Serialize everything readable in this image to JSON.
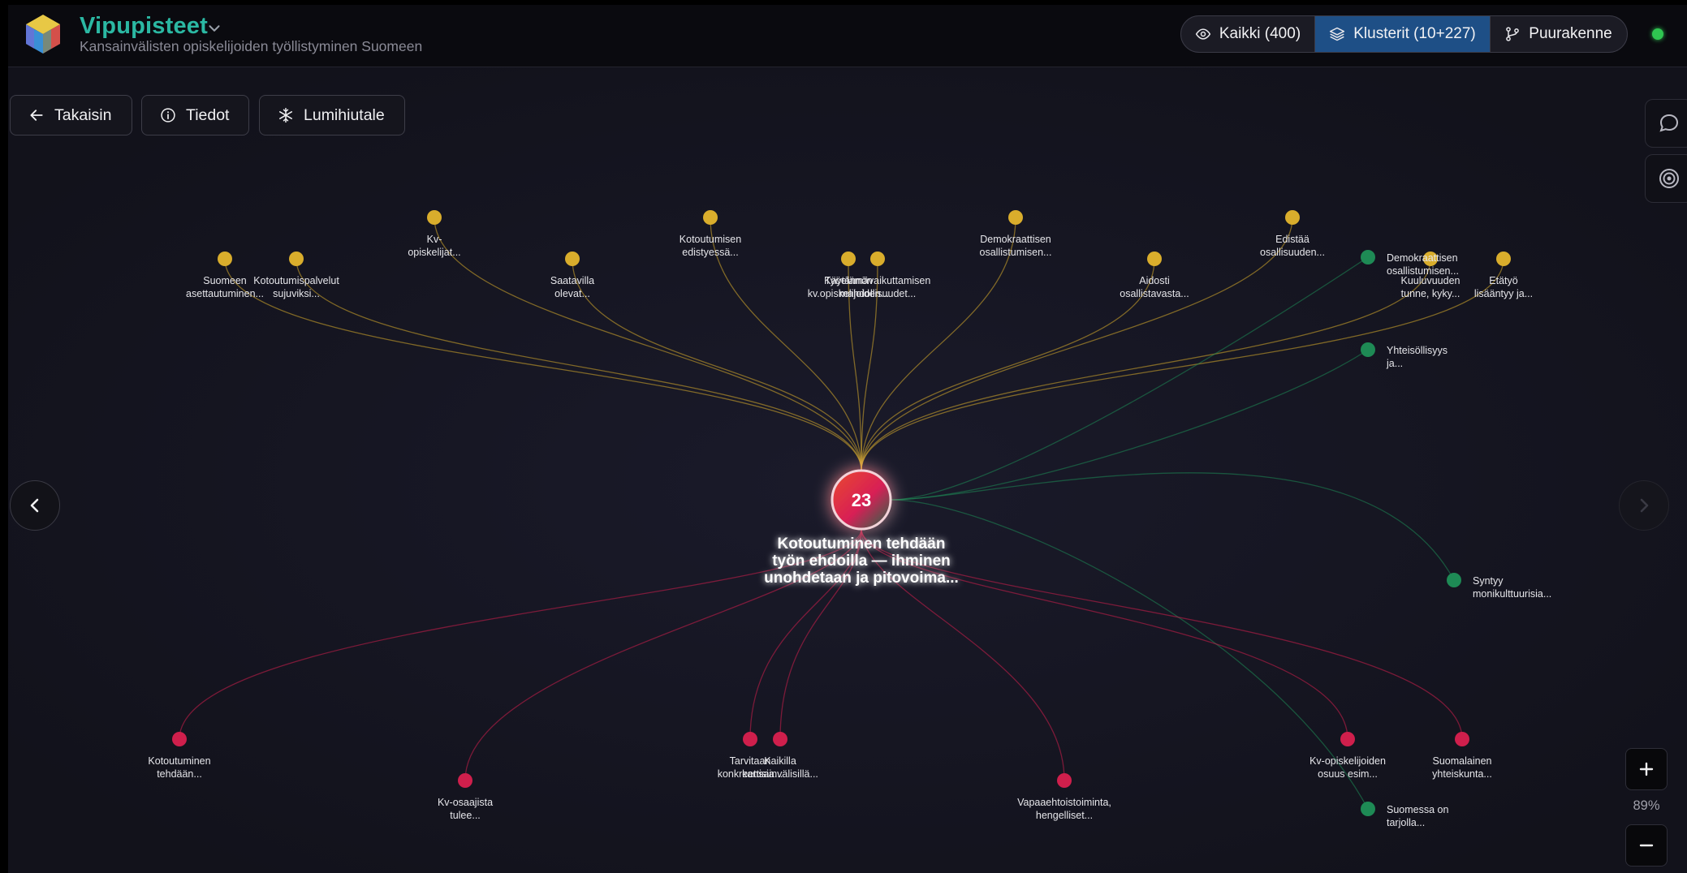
{
  "header": {
    "title": "Vipupisteet",
    "subtitle": "Kansainvälisten opiskelijoiden työllistyminen Suomeen",
    "views": [
      {
        "label": "Kaikki (400)",
        "icon": "eye-icon",
        "active": false
      },
      {
        "label": "Klusterit (10+227)",
        "icon": "layers-icon",
        "active": true
      },
      {
        "label": "Puurakenne",
        "icon": "git-branch-icon",
        "active": false
      }
    ],
    "status": "online",
    "colors": {
      "title": "#2bb8a3",
      "active_view": "#1e4f86",
      "status": "#2fc551"
    }
  },
  "toolbar": {
    "back_label": "Takaisin",
    "info_label": "Tiedot",
    "snowflake_label": "Lumihiutale"
  },
  "side_panel": [
    "chat-icon",
    "target-icon"
  ],
  "zoom": {
    "level": "89%",
    "in_label": "+",
    "out_label": "−"
  },
  "graph": {
    "center": {
      "count": "23",
      "label_lines": [
        "Kotoutuminen tehdään",
        "työn ehdoilla — ihminen",
        "unohdetaan ja pitovoima..."
      ]
    },
    "node_colors": {
      "yellow": "#d9ad2c",
      "green": "#1e8a55",
      "red": "#cf1f4c"
    },
    "nodes": [
      {
        "color": "yellow",
        "lines": [
          "Suomeen",
          "asettautuminen..."
        ]
      },
      {
        "color": "yellow",
        "lines": [
          "Kotoutumispalvelut",
          "sujuviksi..."
        ]
      },
      {
        "color": "yellow",
        "lines": [
          "Kv-",
          "opiskelijat..."
        ]
      },
      {
        "color": "yellow",
        "lines": [
          "Saatavilla",
          "olevat..."
        ]
      },
      {
        "color": "yellow",
        "lines": [
          "Kotoutumisen",
          "edistyessä..."
        ]
      },
      {
        "color": "yellow",
        "lines": [
          "Käytännön",
          "kv.opiskelijoiden..."
        ]
      },
      {
        "color": "yellow",
        "lines": [
          "Työelämävaikuttamisen",
          "mahdollisuudet..."
        ]
      },
      {
        "color": "yellow",
        "lines": [
          "Demokraattisen",
          "osallistumisen..."
        ]
      },
      {
        "color": "yellow",
        "lines": [
          "Aidosti",
          "osallistavasta..."
        ]
      },
      {
        "color": "yellow",
        "lines": [
          "Edistää",
          "osallisuuden..."
        ]
      },
      {
        "color": "yellow",
        "lines": [
          "Kuuluvuuden",
          "tunne, kyky..."
        ]
      },
      {
        "color": "yellow",
        "lines": [
          "Etätyö",
          "lisääntyy ja..."
        ]
      },
      {
        "color": "green",
        "lines": [
          "Demokraattisen",
          "osallistumisen..."
        ]
      },
      {
        "color": "green",
        "lines": [
          "Yhteisöllisyys",
          "ja..."
        ]
      },
      {
        "color": "green",
        "lines": [
          "Syntyy",
          "monikulttuurisia..."
        ]
      },
      {
        "color": "green",
        "lines": [
          "Suomessa on",
          "tarjolla..."
        ]
      },
      {
        "color": "red",
        "lines": [
          "Kotoutuminen",
          "tehdään..."
        ]
      },
      {
        "color": "red",
        "lines": [
          "Kv-osaajista",
          "tulee..."
        ]
      },
      {
        "color": "red",
        "lines": [
          "Tarvitaan",
          "konkreettisia..."
        ]
      },
      {
        "color": "red",
        "lines": [
          "Kaikilla",
          "kansainvälisillä..."
        ]
      },
      {
        "color": "red",
        "lines": [
          "Vapaaehtoistoiminta,",
          "hengelliset..."
        ]
      },
      {
        "color": "red",
        "lines": [
          "Kv-opiskelijoiden",
          "osuus esim..."
        ]
      },
      {
        "color": "red",
        "lines": [
          "Suomalainen",
          "yhteiskunta..."
        ]
      }
    ]
  }
}
